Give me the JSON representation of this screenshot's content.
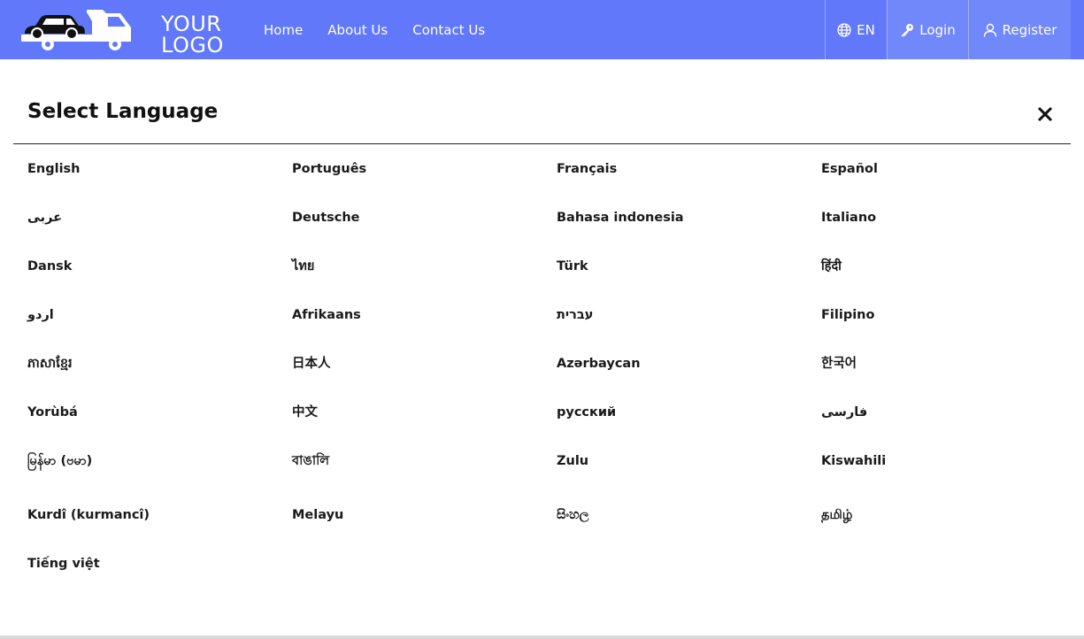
{
  "brand": {
    "logo_line1": "YOUR",
    "logo_line2": "LOGO"
  },
  "nav": {
    "links": [
      "Home",
      "About Us",
      "Contact Us"
    ],
    "language": "EN",
    "login": "Login",
    "register": "Register"
  },
  "modal": {
    "title": "Select Language",
    "languages": [
      "English",
      "Português",
      "Français",
      "Español",
      "عربى",
      "Deutsche",
      "Bahasa indonesia",
      "Italiano",
      "Dansk",
      "ไทย",
      "Türk",
      "हिंदी",
      "اردو",
      "Afrikaans",
      "עברית",
      "Filipino",
      "ភាសាខ្មែរ",
      "日本人",
      "Azərbaycan",
      "한국어",
      "Yorùbá",
      "中文",
      "русский",
      "فارسی",
      "မြန်မာ (ဗမာ)",
      "বাঙালি",
      "Zulu",
      "Kiswahili",
      "Kurdî (kurmancî)",
      "Melayu",
      "සිංහල",
      "தமிழ்",
      "Tiếng việt"
    ]
  }
}
